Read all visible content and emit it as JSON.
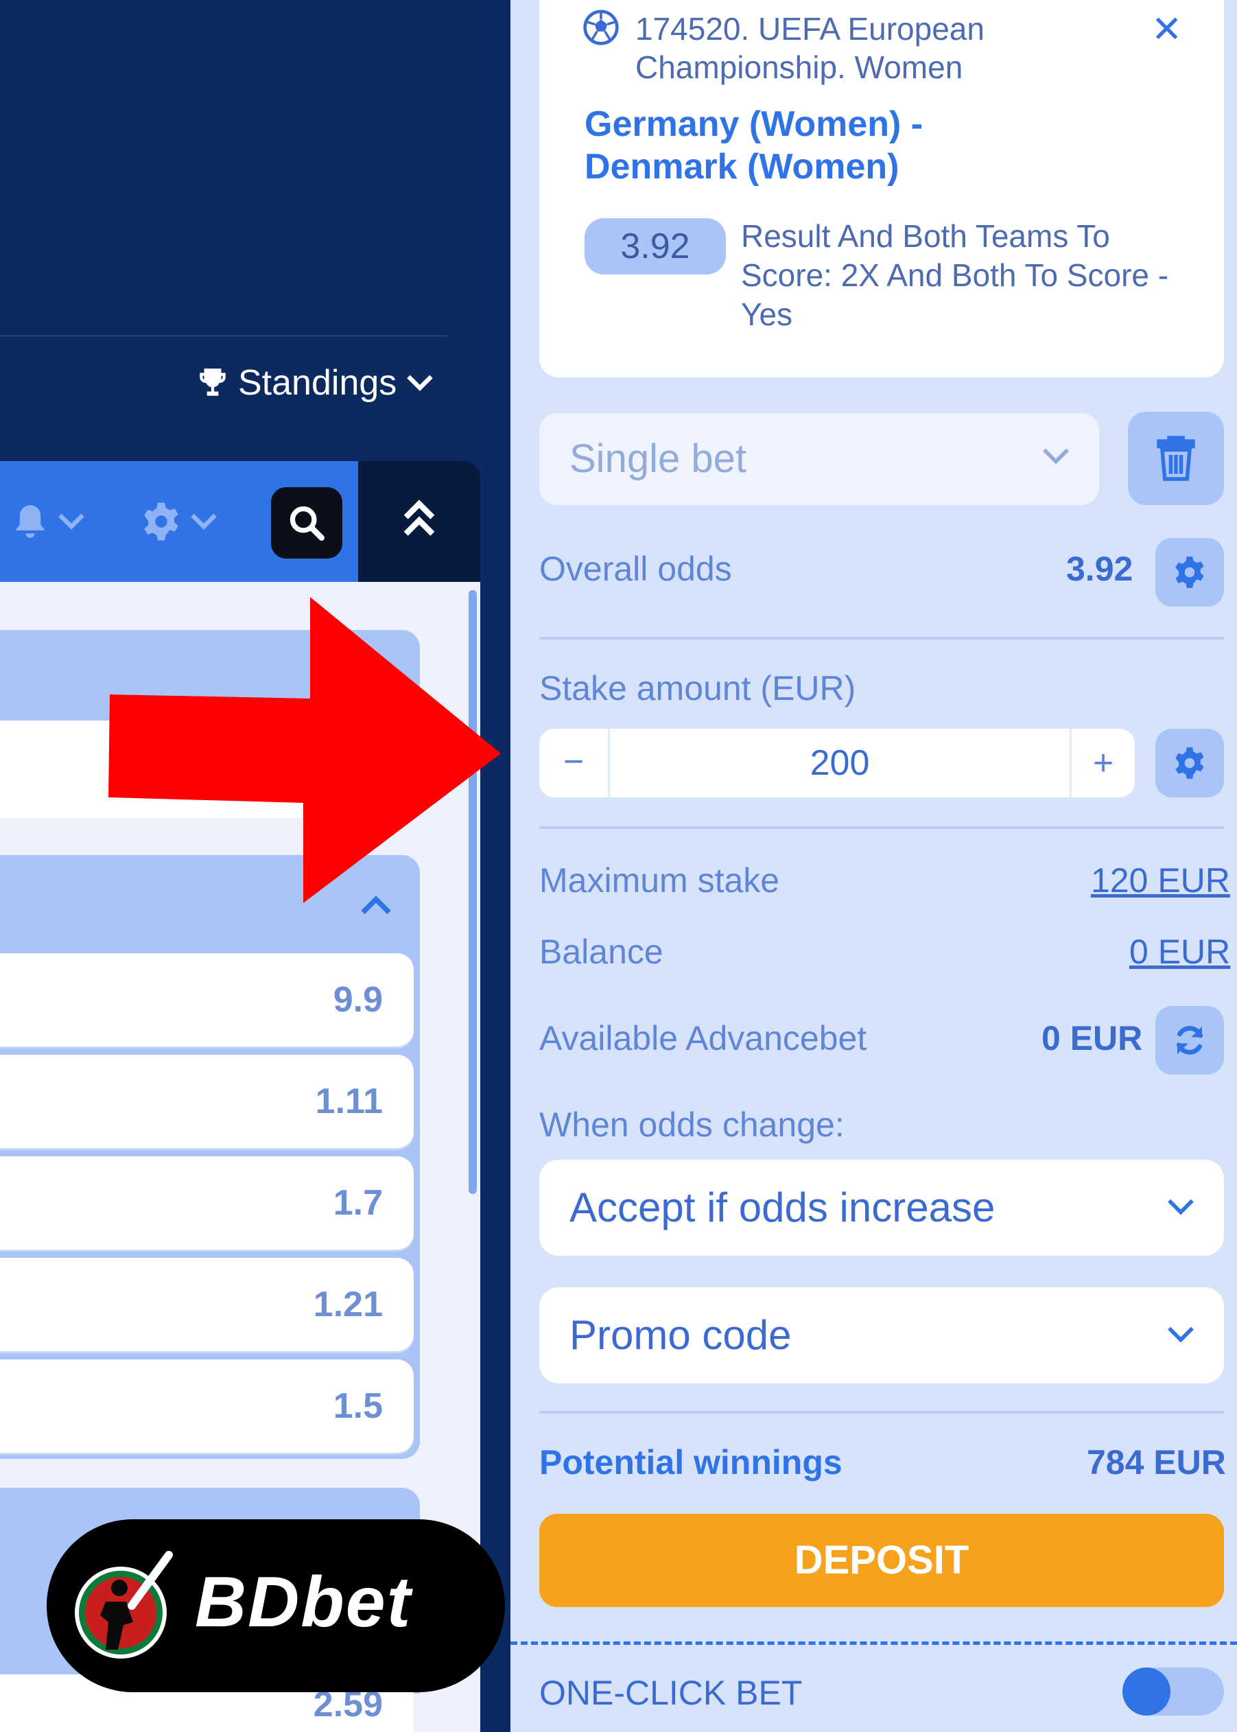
{
  "left": {
    "standings_label": "Standings",
    "odds": [
      "9.9",
      "1.11",
      "1.7",
      "1.21",
      "1.5"
    ],
    "bottom_odd": "2.59",
    "logo_text": "BDbet"
  },
  "event": {
    "league": "174520. UEFA European Championship. Women",
    "teams": "Germany (Women) - Denmark (Women)",
    "odd": "3.92",
    "market": "Result And Both Teams To Score: 2X And Both To Score - Yes",
    "close_symbol": "✕"
  },
  "bet_type": {
    "value": "Single bet"
  },
  "overall_odds": {
    "label": "Overall odds",
    "value": "3.92"
  },
  "stake": {
    "label": "Stake amount (EUR)",
    "value": "200",
    "minus": "−",
    "plus": "+"
  },
  "maximum_stake": {
    "label": "Maximum stake",
    "value": "120 EUR"
  },
  "balance": {
    "label": "Balance",
    "value": "0 EUR"
  },
  "advancebet": {
    "label": "Available Advancebet",
    "value": "0 EUR"
  },
  "odds_change": {
    "label": "When odds change:",
    "value": "Accept if odds increase"
  },
  "promo": {
    "label": "Promo code"
  },
  "potential": {
    "label": "Potential winnings",
    "value": "784 EUR"
  },
  "deposit_label": "DEPOSIT",
  "one_click": {
    "label": "ONE-CLICK BET",
    "enabled": false
  },
  "colors": {
    "accent": "#2f73e6",
    "deposit": "#f7a21c",
    "arrow": "#ff0000",
    "panel": "#d7e3fb"
  },
  "icons": [
    "trophy-icon",
    "chevron-down-icon",
    "bell-icon",
    "gear-icon",
    "search-icon",
    "double-chevron-up-icon",
    "chevron-up-icon",
    "soccer-ball-icon",
    "close-icon",
    "trash-icon",
    "refresh-icon"
  ]
}
